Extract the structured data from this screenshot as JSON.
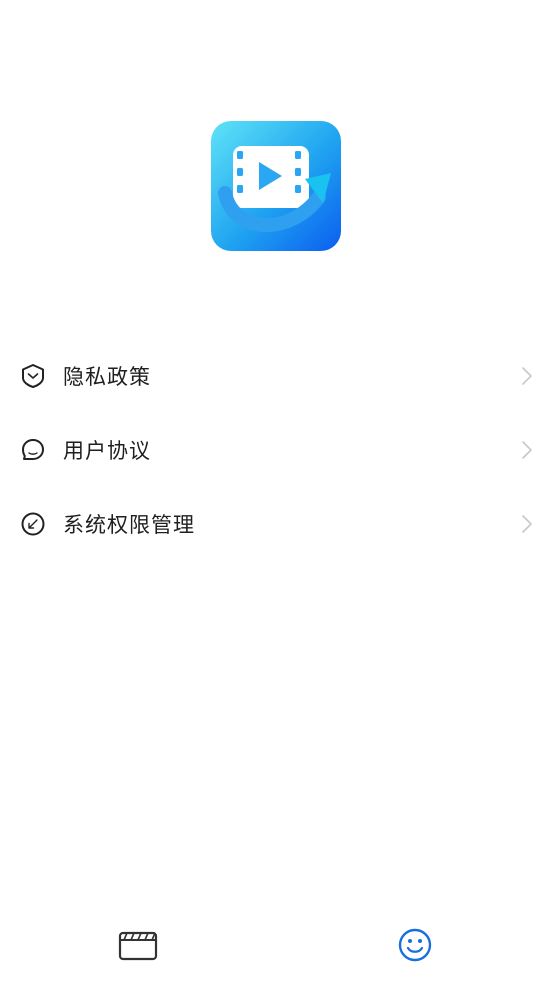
{
  "app": {
    "logo_icon": "video-convert-app-icon"
  },
  "menu": {
    "items": [
      {
        "label": "隐私政策",
        "icon": "shield-icon"
      },
      {
        "label": "用户协议",
        "icon": "chat-bubble-icon"
      },
      {
        "label": "系统权限管理",
        "icon": "compass-icon"
      }
    ]
  },
  "tabbar": {
    "tabs": [
      {
        "icon": "clapperboard-icon",
        "active": false
      },
      {
        "icon": "smiley-icon",
        "active": true
      }
    ],
    "active_color": "#1a6fe0",
    "inactive_color": "#333333"
  }
}
